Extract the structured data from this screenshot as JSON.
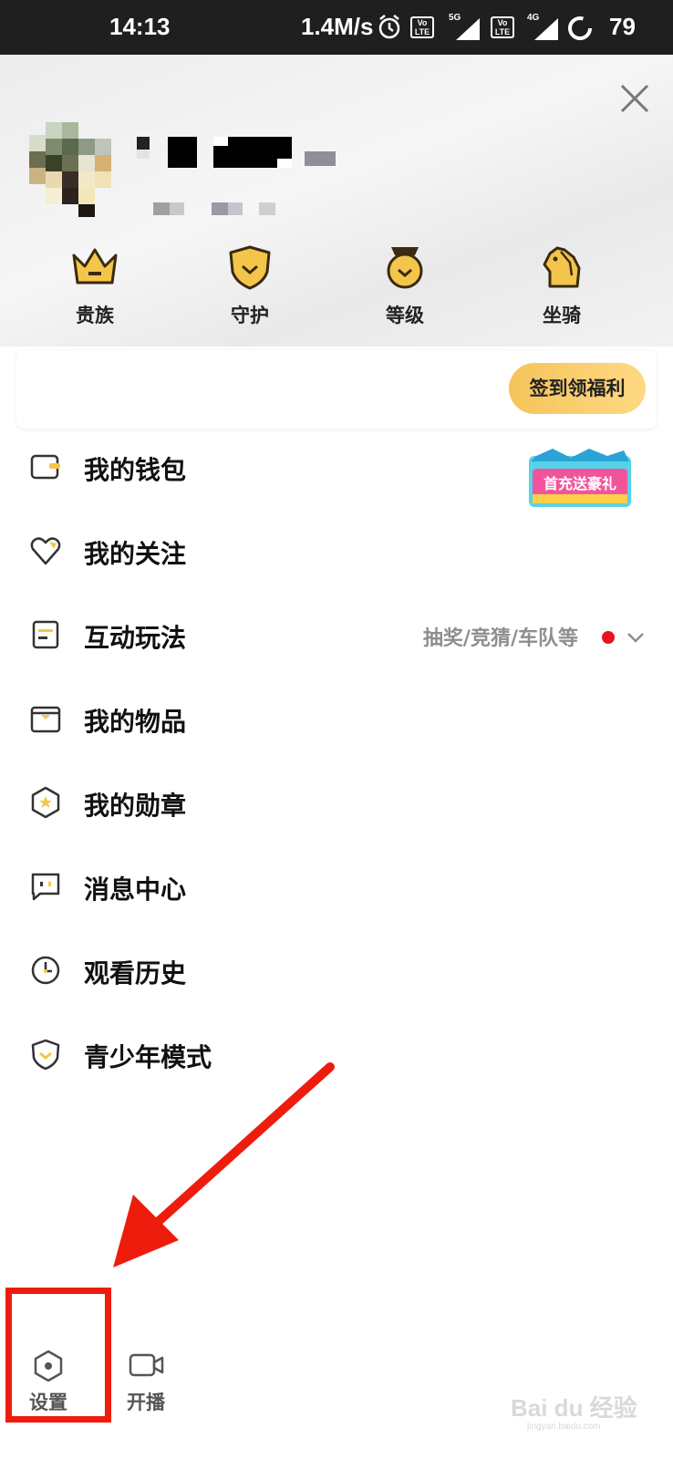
{
  "status_bar": {
    "time": "14:13",
    "network_speed": "1.4M/s",
    "volte_label": "Vo LTE",
    "sim1_label": "5G",
    "sim2_label": "4G",
    "battery": "79"
  },
  "profile": {
    "username": "",
    "subtitle": ""
  },
  "quick_actions": [
    {
      "label": "贵族",
      "icon": "crown-icon"
    },
    {
      "label": "守护",
      "icon": "shield-icon"
    },
    {
      "label": "等级",
      "icon": "medal-icon"
    },
    {
      "label": "坐骑",
      "icon": "horse-icon"
    }
  ],
  "signin": {
    "button_label": "签到领福利"
  },
  "menu": [
    {
      "label": "我的钱包",
      "icon": "wallet-icon",
      "promo": "首充送豪礼"
    },
    {
      "label": "我的关注",
      "icon": "heart-icon"
    },
    {
      "label": "互动玩法",
      "icon": "interactive-icon",
      "extra": "抽奖/竞猜/车队等"
    },
    {
      "label": "我的物品",
      "icon": "box-icon"
    },
    {
      "label": "我的勋章",
      "icon": "badge-icon"
    },
    {
      "label": "消息中心",
      "icon": "message-icon"
    },
    {
      "label": "观看历史",
      "icon": "clock-icon"
    },
    {
      "label": "青少年模式",
      "icon": "youth-shield-icon"
    }
  ],
  "bottom": {
    "settings_label": "设置",
    "broadcast_label": "开播"
  },
  "watermark": {
    "brand": "Bai du 经验",
    "url": "jingyan.baidu.com"
  },
  "colors": {
    "accent_gold": "#f5c35a",
    "highlight_red": "#ee1c0d",
    "status_dot": "#e8131e"
  }
}
